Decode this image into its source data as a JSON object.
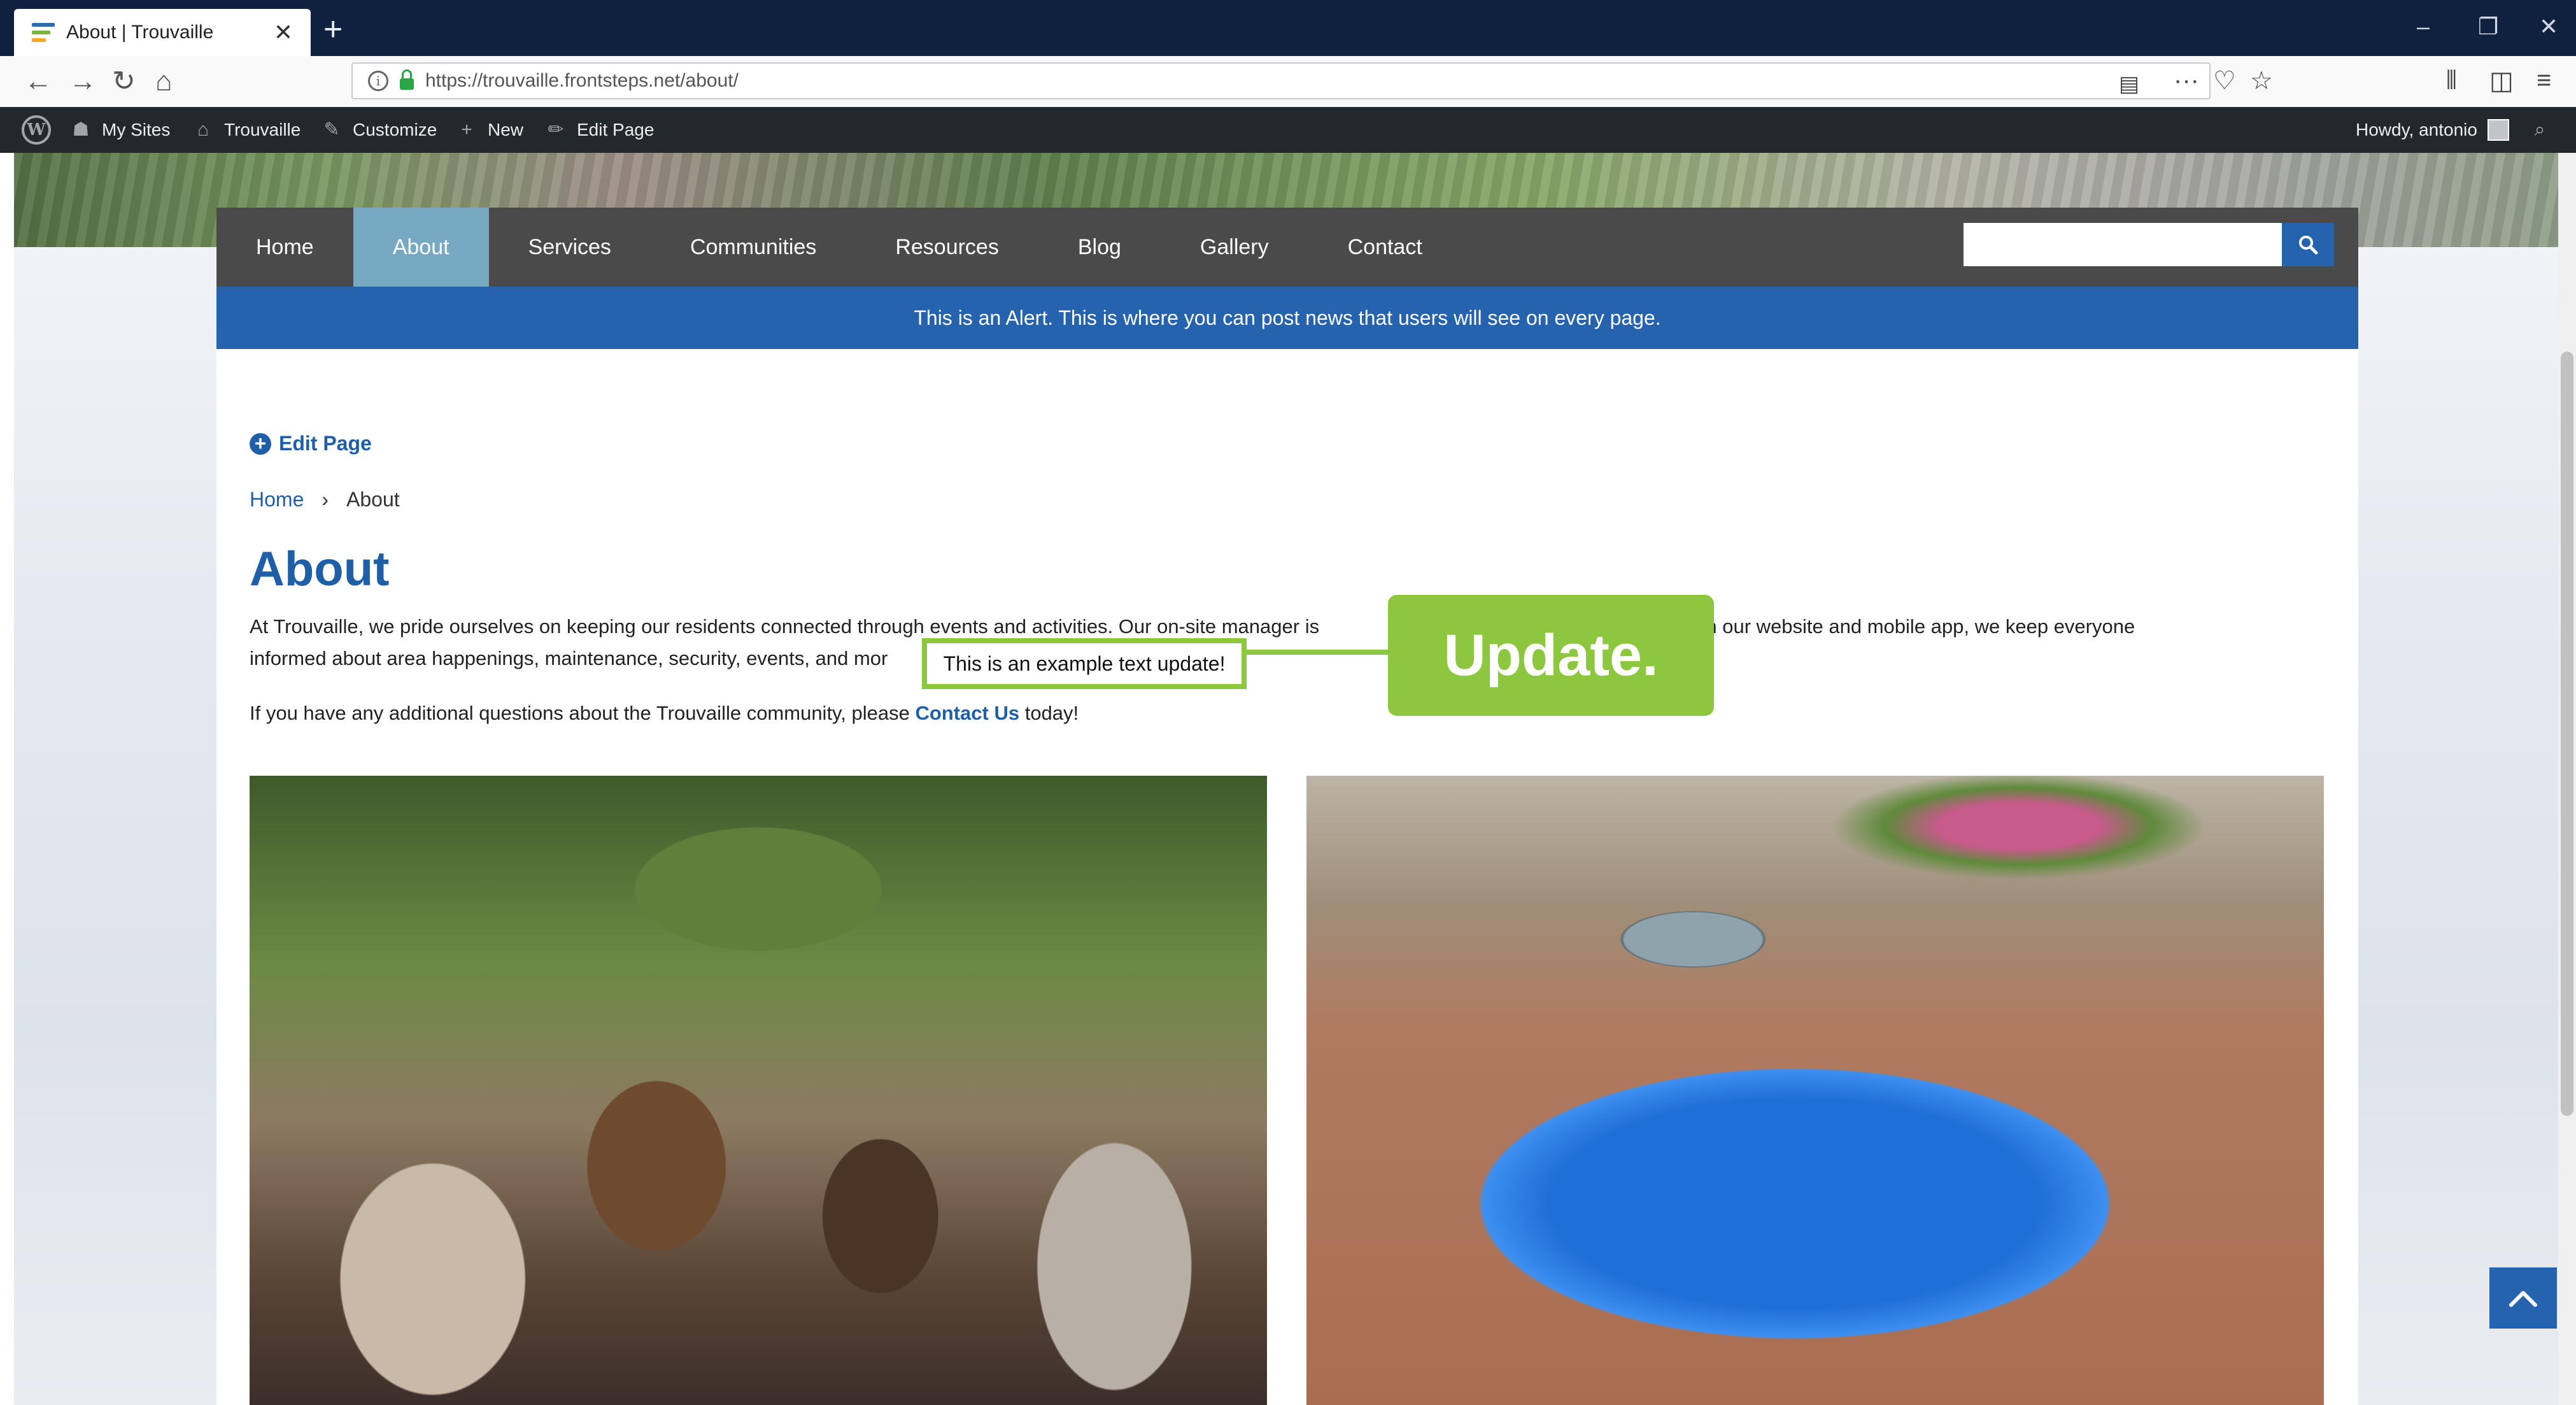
{
  "browser": {
    "tab_title": "About | Trouvaille",
    "url": "https://trouvaille.frontsteps.net/about/"
  },
  "admin_bar": {
    "items": [
      {
        "label": "My Sites",
        "icon": "network-icon"
      },
      {
        "label": "Trouvaille",
        "icon": "home-icon"
      },
      {
        "label": "Customize",
        "icon": "brush-icon"
      },
      {
        "label": "New",
        "icon": "plus-icon"
      },
      {
        "label": "Edit Page",
        "icon": "pencil-icon"
      }
    ],
    "greeting": "Howdy, antonio"
  },
  "site_nav": {
    "items": [
      "Home",
      "About",
      "Services",
      "Communities",
      "Resources",
      "Blog",
      "Gallery",
      "Contact"
    ],
    "active": "About",
    "search_value": ""
  },
  "alert": {
    "text": "This is an Alert. This is where you can post news that users will see on every page."
  },
  "content": {
    "edit_link": "Edit Page",
    "breadcrumb": {
      "home": "Home",
      "separator": "›",
      "current": "About"
    },
    "title": "About",
    "para1_line1": "At Trouvaille, we pride ourselves on keeping our residents connected through events and activities. Our on-site manager is",
    "para1_line1_end": "nt, and through our website and mobile app, we keep everyone",
    "para1_line2": "informed about area happenings, maintenance, security, events, and mor",
    "para2_before": "If you have any additional questions about the Trouvaille community, please ",
    "para2_link": "Contact Us",
    "para2_after": " today!"
  },
  "annotation": {
    "highlighted_text": "This is an example text update!",
    "badge": "Update.",
    "color": "#8dc63f"
  },
  "colors": {
    "brand_blue": "#2563ae",
    "nav_bg": "#4a4a4a",
    "nav_active": "#78a9c3",
    "link": "#1f5fa8"
  }
}
